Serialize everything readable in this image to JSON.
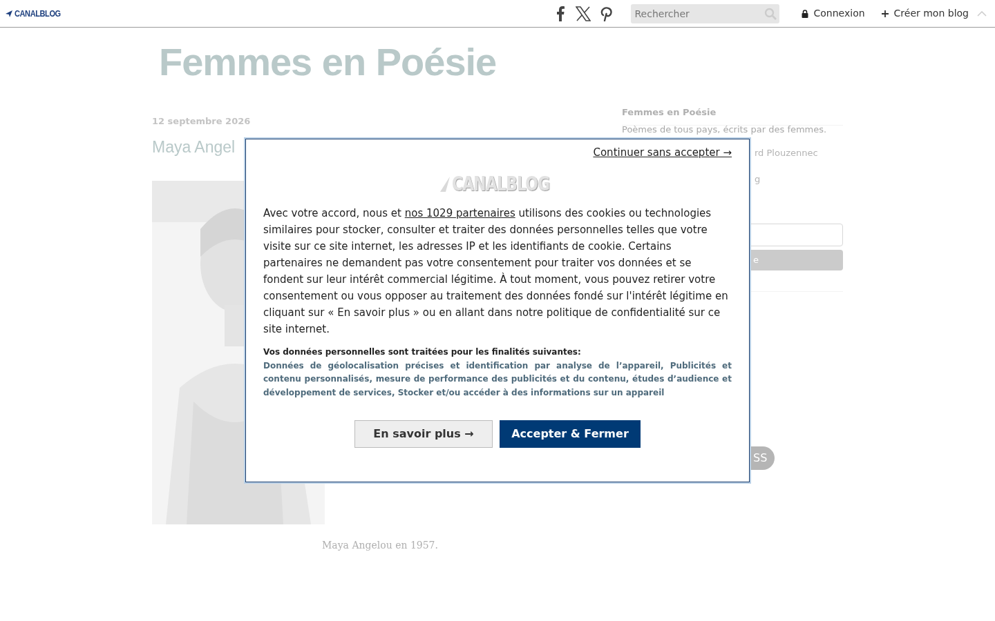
{
  "topbar": {
    "logo": "CANALBLOG",
    "search": {
      "placeholder": "Rechercher"
    },
    "links": [
      {
        "kind": "lock",
        "label": "Connexion"
      },
      {
        "kind": "plus",
        "label": "Créer mon blog"
      }
    ]
  },
  "blog": {
    "title": "Femmes en Poésie"
  },
  "post": {
    "date": "12 septembre 2026",
    "title": "Maya Angel",
    "caption": "Maya Angelou en 1957."
  },
  "sidebar": {
    "heading": "Femmes en Poésie",
    "description": "Poèmes de tous pays, écrits par des femmes.",
    "fragments": [
      "rd Plouzennec",
      "g"
    ],
    "button_fragment": "e",
    "rss_fragment": "SS"
  },
  "consent": {
    "continue_link": "Continuer sans accepter →",
    "logo": "CANALBLOG",
    "text_before": "Avec votre accord, nous et ",
    "partners_link": "nos 1029 partenaires",
    "text_after": " utilisons des cookies ou technologies similaires pour stocker, consulter et traiter des données personnelles telles que votre visite sur ce site internet, les adresses IP et les identifiants de cookie. Certains partenaires ne demandent pas votre consentement pour traiter vos données et se fondent sur leur intérêt commercial légitime. À tout moment, vous pouvez retirer votre consentement ou vous opposer au traitement des données fondé sur l'intérêt légitime en cliquant sur « En savoir plus » ou en allant dans notre politique de confidentialité sur ce site internet.",
    "purposes_heading": "Vos données personnelles sont traitées pour les finalités suivantes:",
    "purposes": "Données de géolocalisation précises et identification par analyse de l’appareil, Publicités et contenu personnalisés, mesure de performance des publicités et du contenu, études d’audience et développement de services, Stocker et/ou accéder à des informations sur un appareil",
    "buttons": [
      {
        "kind": "secondary",
        "label": "En savoir plus →"
      },
      {
        "kind": "primary",
        "label": "Accepter & Fermer"
      }
    ]
  }
}
